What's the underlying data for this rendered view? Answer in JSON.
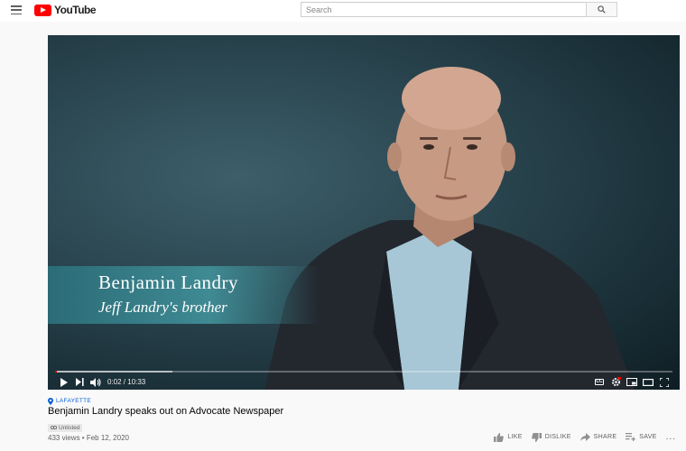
{
  "header": {
    "logo_text": "YouTube",
    "search_placeholder": "Search"
  },
  "player": {
    "overlay_name": "Benjamin Landry",
    "overlay_subtitle": "Jeff Landry's brother",
    "time_display": "0:02 / 10:33",
    "cc_label": "CC",
    "progress_fraction": 0.003,
    "buffer_fraction": 0.19
  },
  "video": {
    "location": "LAFAYETTE",
    "title": "Benjamin Landry speaks out on Advocate Newspaper",
    "visibility": "Unlisted",
    "stats": "433 views • Feb 12, 2020"
  },
  "actions": {
    "like": "LIKE",
    "dislike": "DISLIKE",
    "share": "SHARE",
    "save": "SAVE",
    "more": "..."
  },
  "colors": {
    "brand_red": "#ff0000",
    "link_blue": "#065fd4",
    "lower_third_teal": "#3f8a93"
  }
}
